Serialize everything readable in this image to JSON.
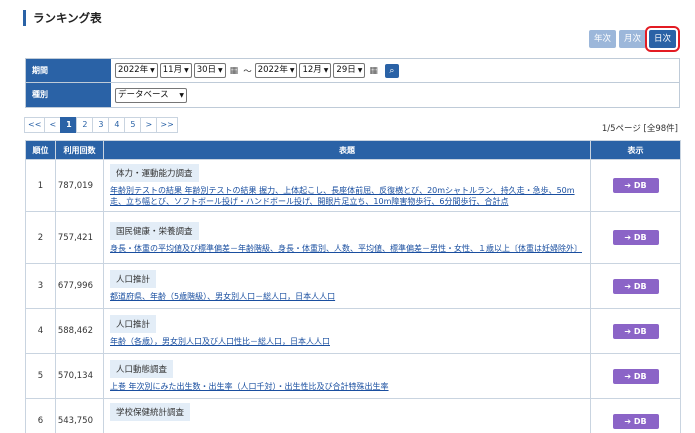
{
  "page": {
    "title": "ランキング表"
  },
  "period_tabs": [
    {
      "label": "年次",
      "active": false
    },
    {
      "label": "月次",
      "active": false
    },
    {
      "label": "日次",
      "active": true
    }
  ],
  "filter": {
    "period_label": "期間",
    "from": {
      "year": "2022年",
      "month": "11月",
      "day": "30日"
    },
    "tilde": "～",
    "to": {
      "year": "2022年",
      "month": "12月",
      "day": "29日"
    },
    "type_label": "種別",
    "type_value": "データベース"
  },
  "pager": {
    "items": [
      "<<",
      "<",
      "1",
      "2",
      "3",
      "4",
      "5",
      ">",
      ">>"
    ],
    "current": "1",
    "info": "1/5ページ [全98件]"
  },
  "table": {
    "headers": {
      "rank": "順位",
      "count": "利用回数",
      "title": "表題",
      "display": "表示"
    },
    "db_label": "DB",
    "rows": [
      {
        "rank": "1",
        "count": "787,019",
        "survey": "体力・運動能力調査",
        "link": "年齢別テストの結果 年齢別テストの結果 握力、上体起こし、長座体前屈、反復横とび、20mシャトルラン、持久走・急歩、50m走、立ち幅とび、ソフトボール投げ・ハンドボール投げ、開眼片足立ち、10m障害物歩行、6分間歩行、合計点"
      },
      {
        "rank": "2",
        "count": "757,421",
        "survey": "国民健康・栄養調査",
        "link": "身長・体重の平均値及び標準偏差－年齢階級、身長・体重別、人数、平均値、標準偏差－男性・女性、１歳以上〔体重は妊婦除外〕"
      },
      {
        "rank": "3",
        "count": "677,996",
        "survey": "人口推計",
        "link": "都道府県、年齢（5歳階級）、男女別人口－総人口，日本人人口"
      },
      {
        "rank": "4",
        "count": "588,462",
        "survey": "人口推計",
        "link": "年齢（各歳），男女別人口及び人口性比－総人口，日本人人口"
      },
      {
        "rank": "5",
        "count": "570,134",
        "survey": "人口動態調査",
        "link": "上巻 年次別にみた出生数・出生率（人口千対）・出生性比及び合計特殊出生率"
      },
      {
        "rank": "6",
        "count": "543,750",
        "survey": "学校保健統計調査",
        "link": ""
      }
    ]
  },
  "icons": {
    "calendar": "calendar-icon",
    "search": "search-icon",
    "arrow": "arrow-right-icon"
  }
}
